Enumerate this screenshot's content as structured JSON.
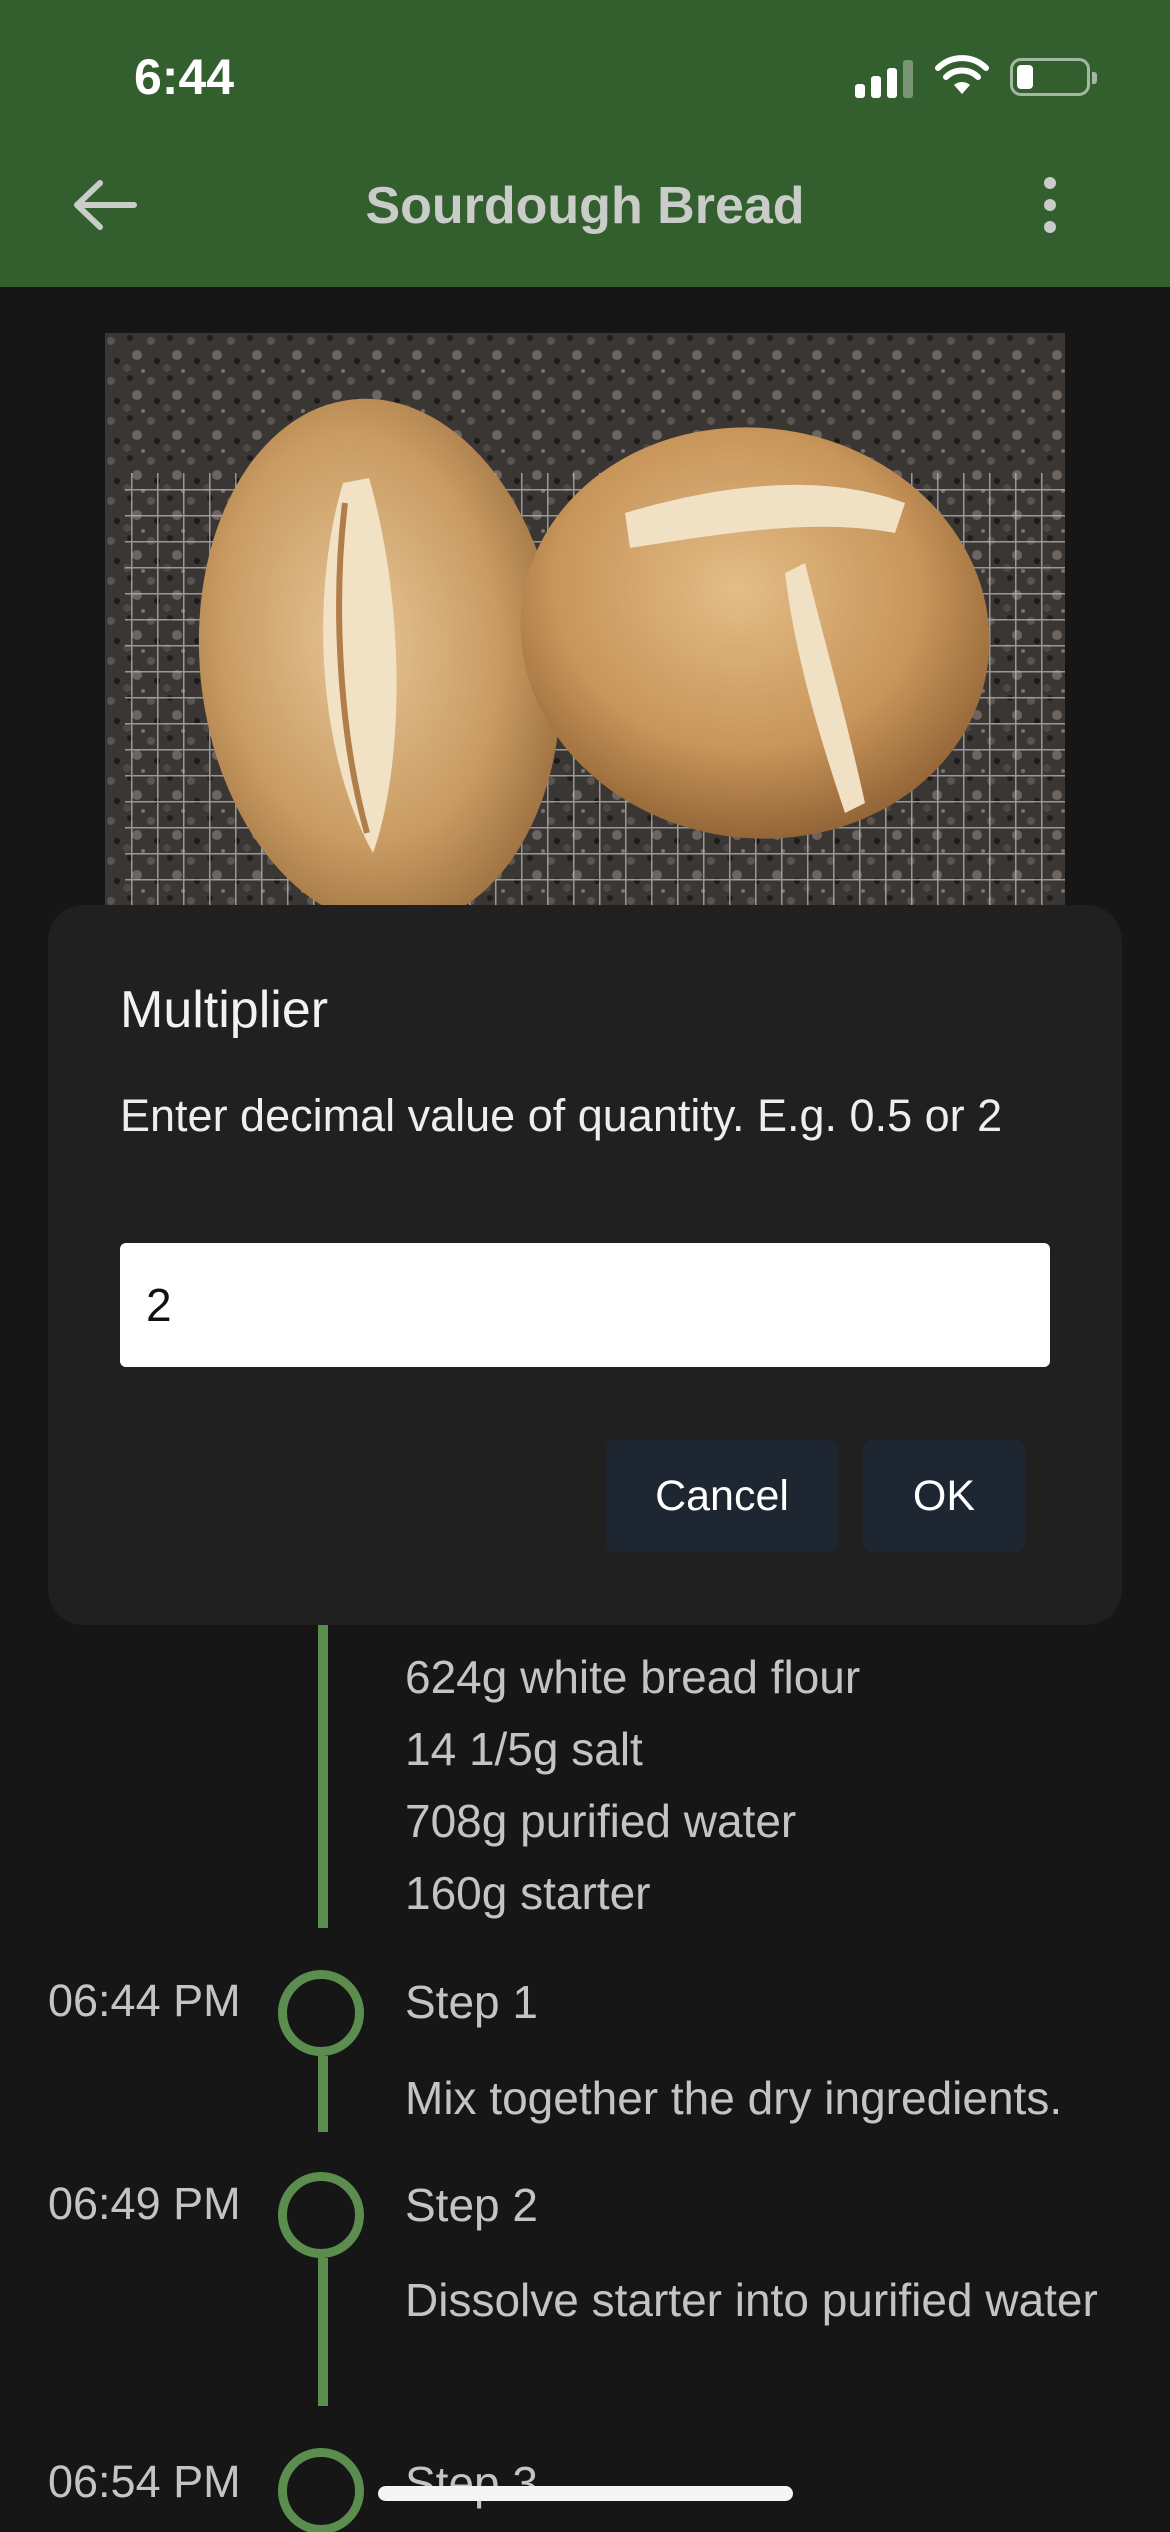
{
  "status_bar": {
    "time": "6:44"
  },
  "app_bar": {
    "title": "Sourdough Bread",
    "back_icon": "arrow-left-icon",
    "menu_icon": "more-vertical-icon"
  },
  "colors": {
    "app_bar": "#335f2f",
    "background": "#161616",
    "dialog": "#202020",
    "accent_green": "#5b8d4f",
    "button": "#1e2631"
  },
  "dialog": {
    "title": "Multiplier",
    "message": "Enter decimal value of quantity. E.g. 0.5 or 2",
    "input_value": "2",
    "cancel_label": "Cancel",
    "ok_label": "OK"
  },
  "ingredients": [
    "624g white bread flour",
    "14 1/5g salt",
    "708g purified water",
    "160g starter"
  ],
  "steps": [
    {
      "time": "06:44 PM",
      "title": "Step 1",
      "description": "Mix together the dry ingredients."
    },
    {
      "time": "06:49 PM",
      "title": "Step 2",
      "description": "Dissolve starter into purified water"
    },
    {
      "time": "06:54 PM",
      "title": "Step 3"
    }
  ]
}
